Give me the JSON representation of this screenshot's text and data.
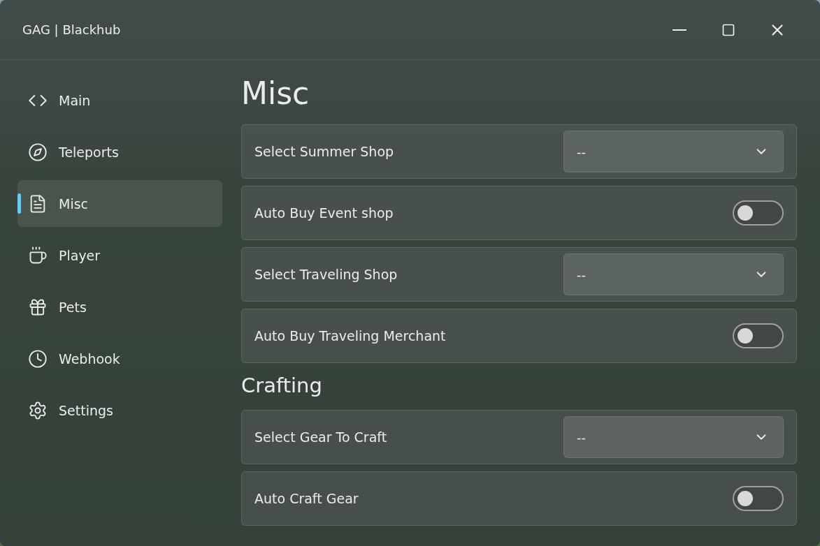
{
  "window": {
    "title": "GAG | Blackhub"
  },
  "sidebar": {
    "items": [
      {
        "label": "Main",
        "selected": false
      },
      {
        "label": "Teleports",
        "selected": false
      },
      {
        "label": "Misc",
        "selected": true
      },
      {
        "label": "Player",
        "selected": false
      },
      {
        "label": "Pets",
        "selected": false
      },
      {
        "label": "Webhook",
        "selected": false
      },
      {
        "label": "Settings",
        "selected": false
      }
    ]
  },
  "page": {
    "title": "Misc",
    "sections": [
      {
        "rows": [
          {
            "kind": "dropdown",
            "label": "Select Summer Shop",
            "value": "--"
          },
          {
            "kind": "toggle",
            "label": "Auto Buy Event shop",
            "on": false
          },
          {
            "kind": "dropdown",
            "label": "Select Traveling Shop",
            "value": "--"
          },
          {
            "kind": "toggle",
            "label": "Auto Buy Traveling Merchant",
            "on": false
          }
        ]
      },
      {
        "title": "Crafting",
        "rows": [
          {
            "kind": "dropdown",
            "label": "Select Gear To Craft",
            "value": "--"
          },
          {
            "kind": "toggle",
            "label": "Auto Craft Gear",
            "on": false
          }
        ]
      }
    ]
  }
}
